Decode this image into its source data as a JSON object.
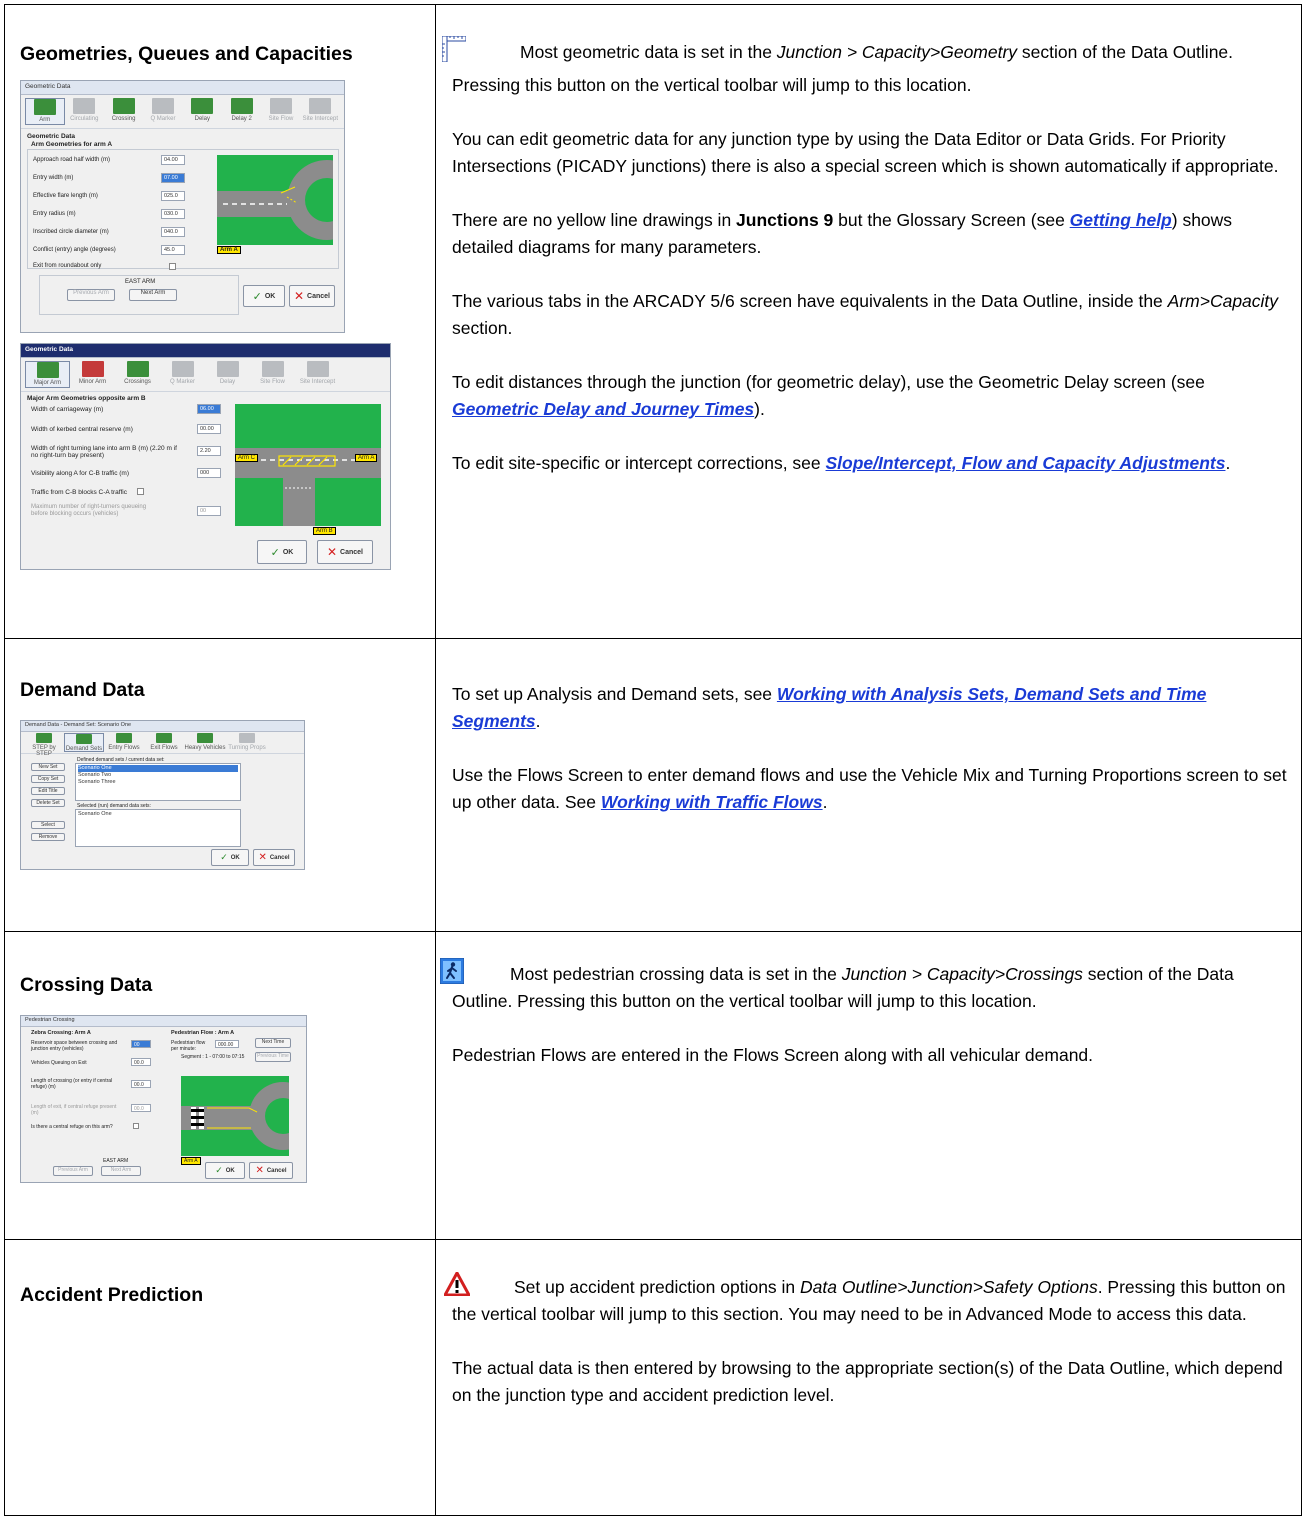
{
  "sections": [
    {
      "heading": "Geometries, Queues and Capacities",
      "p1_a": "Most geometric data is set in the ",
      "p1_em": "Junction > Capacity>Geometry",
      "p1_b": " section of the Data Outline.  Pressing this button on the vertical toolbar will jump to this location.",
      "p2": "You can edit geometric data for any junction type by using the Data Editor or Data Grids.  For Priority Intersections (PICADY junctions) there is also a special screen which is shown automatically if appropriate.",
      "p3_a": "There are no yellow line drawings in ",
      "p3_bold": "Junctions 9",
      "p3_b": " but the Glossary Screen (see ",
      "p3_link": "Getting help",
      "p3_c": ") shows detailed diagrams for many parameters.",
      "p4_a": "The various tabs in the ARCADY 5/6 screen have equivalents in the Data Outline, inside the ",
      "p4_em": "Arm>Capacity",
      "p4_b": " section.",
      "p5_a": "To edit distances through the junction (for geometric delay), use the Geometric Delay screen (see ",
      "p5_link": "Geometric Delay and Journey Times",
      "p5_b": ").",
      "p6_a": "To edit site-specific or intercept corrections, see ",
      "p6_link": "Slope/Intercept, Flow and Capacity Adjustments",
      "p6_b": "."
    },
    {
      "heading": "Demand Data",
      "p1_a": "To set up Analysis and Demand sets, see ",
      "p1_link": "Working with Analysis Sets, Demand Sets and Time Segments",
      "p1_b": ".",
      "p2_a": "Use the Flows Screen to enter demand flows and use the Vehicle Mix and Turning Proportions screen to set up other data.  See ",
      "p2_link": "Working with Traffic Flows",
      "p2_b": "."
    },
    {
      "heading": "Crossing Data",
      "p1_a": "Most pedestrian crossing data is set in the ",
      "p1_em": "Junction > Capacity>Crossings",
      "p1_b": " section of the Data Outline.  Pressing this button on the vertical toolbar will jump to this location.",
      "p2": "Pedestrian Flows are entered in the Flows Screen along with all vehicular demand."
    },
    {
      "heading": "Accident Prediction",
      "p1_a": "Set up accident prediction options in ",
      "p1_em": "Data Outline>Junction>Safety Options",
      "p1_b": ".  Pressing this button on the vertical toolbar will jump to this section.  You may need to be in Advanced Mode to access this data.",
      "p2": "The actual data is then entered by browsing to the appropriate section(s) of the Data Outline, which depend on the junction type and accident prediction level."
    }
  ],
  "shot1": {
    "title": "Geometric Data",
    "tabs": [
      "Arm",
      "Circulating",
      "Crossing",
      "Q Marker",
      "Delay",
      "Delay 2",
      "Site Flow",
      "Site Intercept"
    ],
    "group": "Geometric Data",
    "sub": "Arm Geometries for arm A",
    "fields": [
      "Approach road half width (m)",
      "Entry width (m)",
      "Effective flare length (m)",
      "Entry radius (m)",
      "Inscribed circle diameter (m)",
      "Conflict (entry) angle (degrees)",
      "Exit from roundabout only"
    ],
    "values": [
      "04.00",
      "07.00",
      "025.0",
      "030.0",
      "040.0",
      "45.0"
    ],
    "arm_label": "Arm A",
    "footer": "EAST ARM",
    "prev": "Previous Arm",
    "next": "Next Arm",
    "ok": "OK",
    "cancel": "Cancel"
  },
  "shot2": {
    "title": "Geometric Data",
    "tabs": [
      "Major Arm",
      "Minor Arm",
      "Crossings",
      "Q Marker",
      "Delay",
      "Site Flow",
      "Site Intercept"
    ],
    "sub": "Major Arm Geometries opposite arm B",
    "fields": [
      "Width of carriageway (m)",
      "Width of kerbed central reserve (m)",
      "Width of right turning lane into arm B (m) (2.20 m if no right-turn bay present)",
      "Visibility along A for C-B traffic (m)",
      "Traffic from C-B blocks C-A traffic",
      "Maximum number of right-turners queueing before blocking occurs (vehicles)"
    ],
    "values": [
      "06.00",
      "00.00",
      "2.20",
      "000",
      "00"
    ],
    "arm_c": "Arm C",
    "arm_a": "Arm A",
    "arm_b": "Arm B",
    "ok": "OK",
    "cancel": "Cancel"
  },
  "shot3": {
    "title": "Demand Data - Demand Set: Scenario One",
    "tabs": [
      "STEP by STEP",
      "Demand Sets",
      "Entry Flows",
      "Exit Flows",
      "Heavy Vehicles",
      "Turning Props"
    ],
    "defined": "Defined demand sets / current data set:",
    "items": [
      "Scenario One",
      "Scenario Two",
      "Scenario Three"
    ],
    "selected_label": "Selected (run) demand data sets:",
    "selected_items": [
      "Scenario One"
    ],
    "buttons": [
      "New Set",
      "Copy Set",
      "Edit Title",
      "Delete Set",
      "Select",
      "Remove"
    ],
    "ok": "OK",
    "cancel": "Cancel"
  },
  "shot4": {
    "title": "Pedestrian Crossing",
    "left_head": "Zebra Crossing: Arm A",
    "right_head": "Pedestrian Flow : Arm A",
    "fields": [
      "Reservoir space between crossing and junction entry (vehicles)",
      "Vehicles Queuing on Exit",
      "Length of crossing (or entry if central refuge) (m)",
      "Length of exit, if central refuge present (m)",
      "Is there a central refuge on this arm?"
    ],
    "values": [
      "00",
      "00.0",
      "00.0",
      "00.0"
    ],
    "ped_label": "Pedestrian flow per minute:",
    "ped_value": "000.00",
    "segment": "Segment : 1 - 07:00 to 07:15",
    "next_time": "Next Time",
    "prev_time": "Previous Time",
    "arm_label": "Arm A",
    "footer": "EAST ARM",
    "prev": "Previous Arm",
    "next": "Next Arm",
    "ok": "OK",
    "cancel": "Cancel"
  }
}
